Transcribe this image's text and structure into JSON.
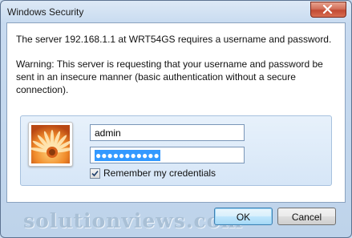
{
  "window": {
    "title": "Windows Security"
  },
  "message": {
    "line1": "The server 192.168.1.1 at WRT54GS requires a username and password.",
    "warning": "Warning: This server is requesting that your username and password be sent in an insecure manner (basic authentication without a secure connection)."
  },
  "credentials": {
    "username": "admin",
    "password_masked": "●●●●●●●●●●●",
    "remember_label": "Remember my credentials",
    "remember_checked": true
  },
  "buttons": {
    "ok": "OK",
    "cancel": "Cancel"
  },
  "watermark": "solutionviews.com",
  "icons": {
    "close": "close-icon",
    "avatar": "user-tile-flower-icon",
    "check": "checkmark-icon"
  },
  "colors": {
    "selection": "#3399ff",
    "close_button": "#c24a33",
    "panel_bg": "#e7f1fb"
  }
}
